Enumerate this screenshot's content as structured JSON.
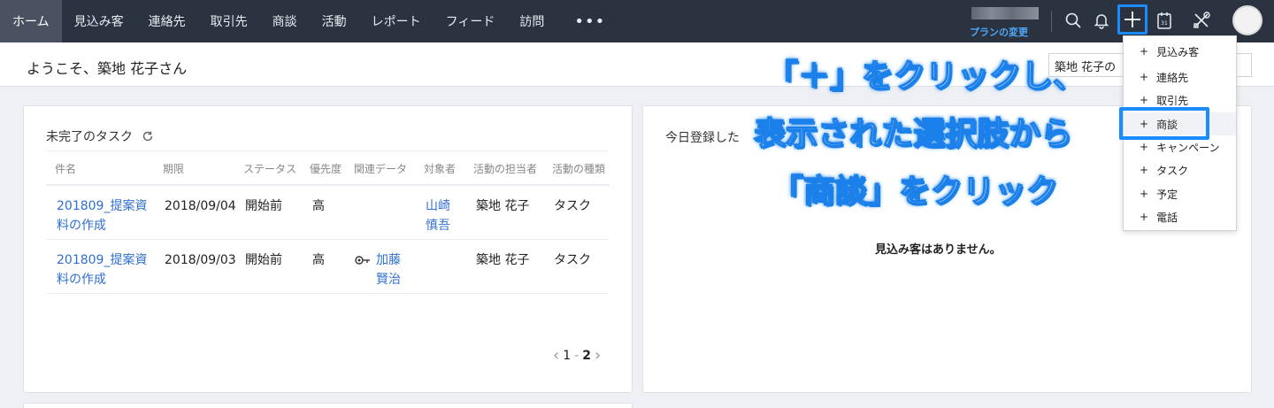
{
  "nav": {
    "tabs": [
      "ホーム",
      "見込み客",
      "連絡先",
      "取引先",
      "商談",
      "活動",
      "レポート",
      "フィード",
      "訪問"
    ],
    "more": "•••",
    "plan_link": "プランの変更"
  },
  "welcome": {
    "text": "ようこそ、築地 花子さん",
    "user_select": "築地 花子の"
  },
  "tasks": {
    "title": "未完了のタスク",
    "columns": [
      "件名",
      "期限",
      "ステータス",
      "優先度",
      "関連データ",
      "対象者",
      "活動の担当者",
      "活動の種類"
    ],
    "rows": [
      {
        "subject": "201809_提案資料の作成",
        "due": "2018/09/04",
        "status": "開始前",
        "priority": "高",
        "related": "",
        "target": "山崎 慎吾",
        "owner": "築地 花子",
        "type": "タスク"
      },
      {
        "subject": "201809_提案資料の作成",
        "due": "2018/09/03",
        "status": "開始前",
        "priority": "高",
        "related": "加藤 賢治",
        "target": "",
        "owner": "築地 花子",
        "type": "タスク"
      }
    ],
    "pager": {
      "current": "1",
      "separator": "-",
      "total": "2"
    }
  },
  "leads": {
    "title": "今日登録した",
    "empty": "見込み客はありません。"
  },
  "create_menu": {
    "items": [
      "見込み客",
      "連絡先",
      "取引先",
      "商談",
      "キャンペーン",
      "タスク",
      "予定",
      "電話"
    ]
  },
  "annotation": {
    "line1": "「＋」をクリックし、",
    "line2": "表示された選択肢から",
    "line3": "「商談」をクリック"
  },
  "colors": {
    "accent": "#1a8cff",
    "nav_bg": "#2b3240",
    "link": "#2f6fcf"
  }
}
